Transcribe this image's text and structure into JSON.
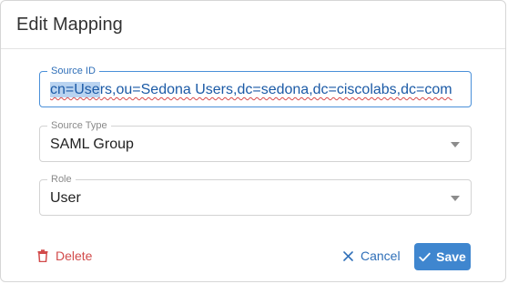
{
  "dialog": {
    "title": "Edit Mapping"
  },
  "fields": {
    "source_id": {
      "label": "Source ID",
      "value_selected": "cn=Use",
      "value_rest_squiggled": "rs",
      "value_rest": ",ou=Sedona Users,dc=sedona,dc=ciscolabs,dc=com"
    },
    "source_type": {
      "label": "Source Type",
      "value": "SAML Group"
    },
    "role": {
      "label": "Role",
      "value": "User"
    }
  },
  "actions": {
    "delete_label": "Delete",
    "cancel_label": "Cancel",
    "save_label": "Save"
  },
  "icons": {
    "delete": "trash-icon",
    "cancel": "close-icon",
    "save": "check-icon",
    "select_caret": "chevron-down-icon"
  },
  "colors": {
    "primary": "#3f86cf",
    "danger": "#d24b4b",
    "focus_border": "#4a90d9"
  }
}
